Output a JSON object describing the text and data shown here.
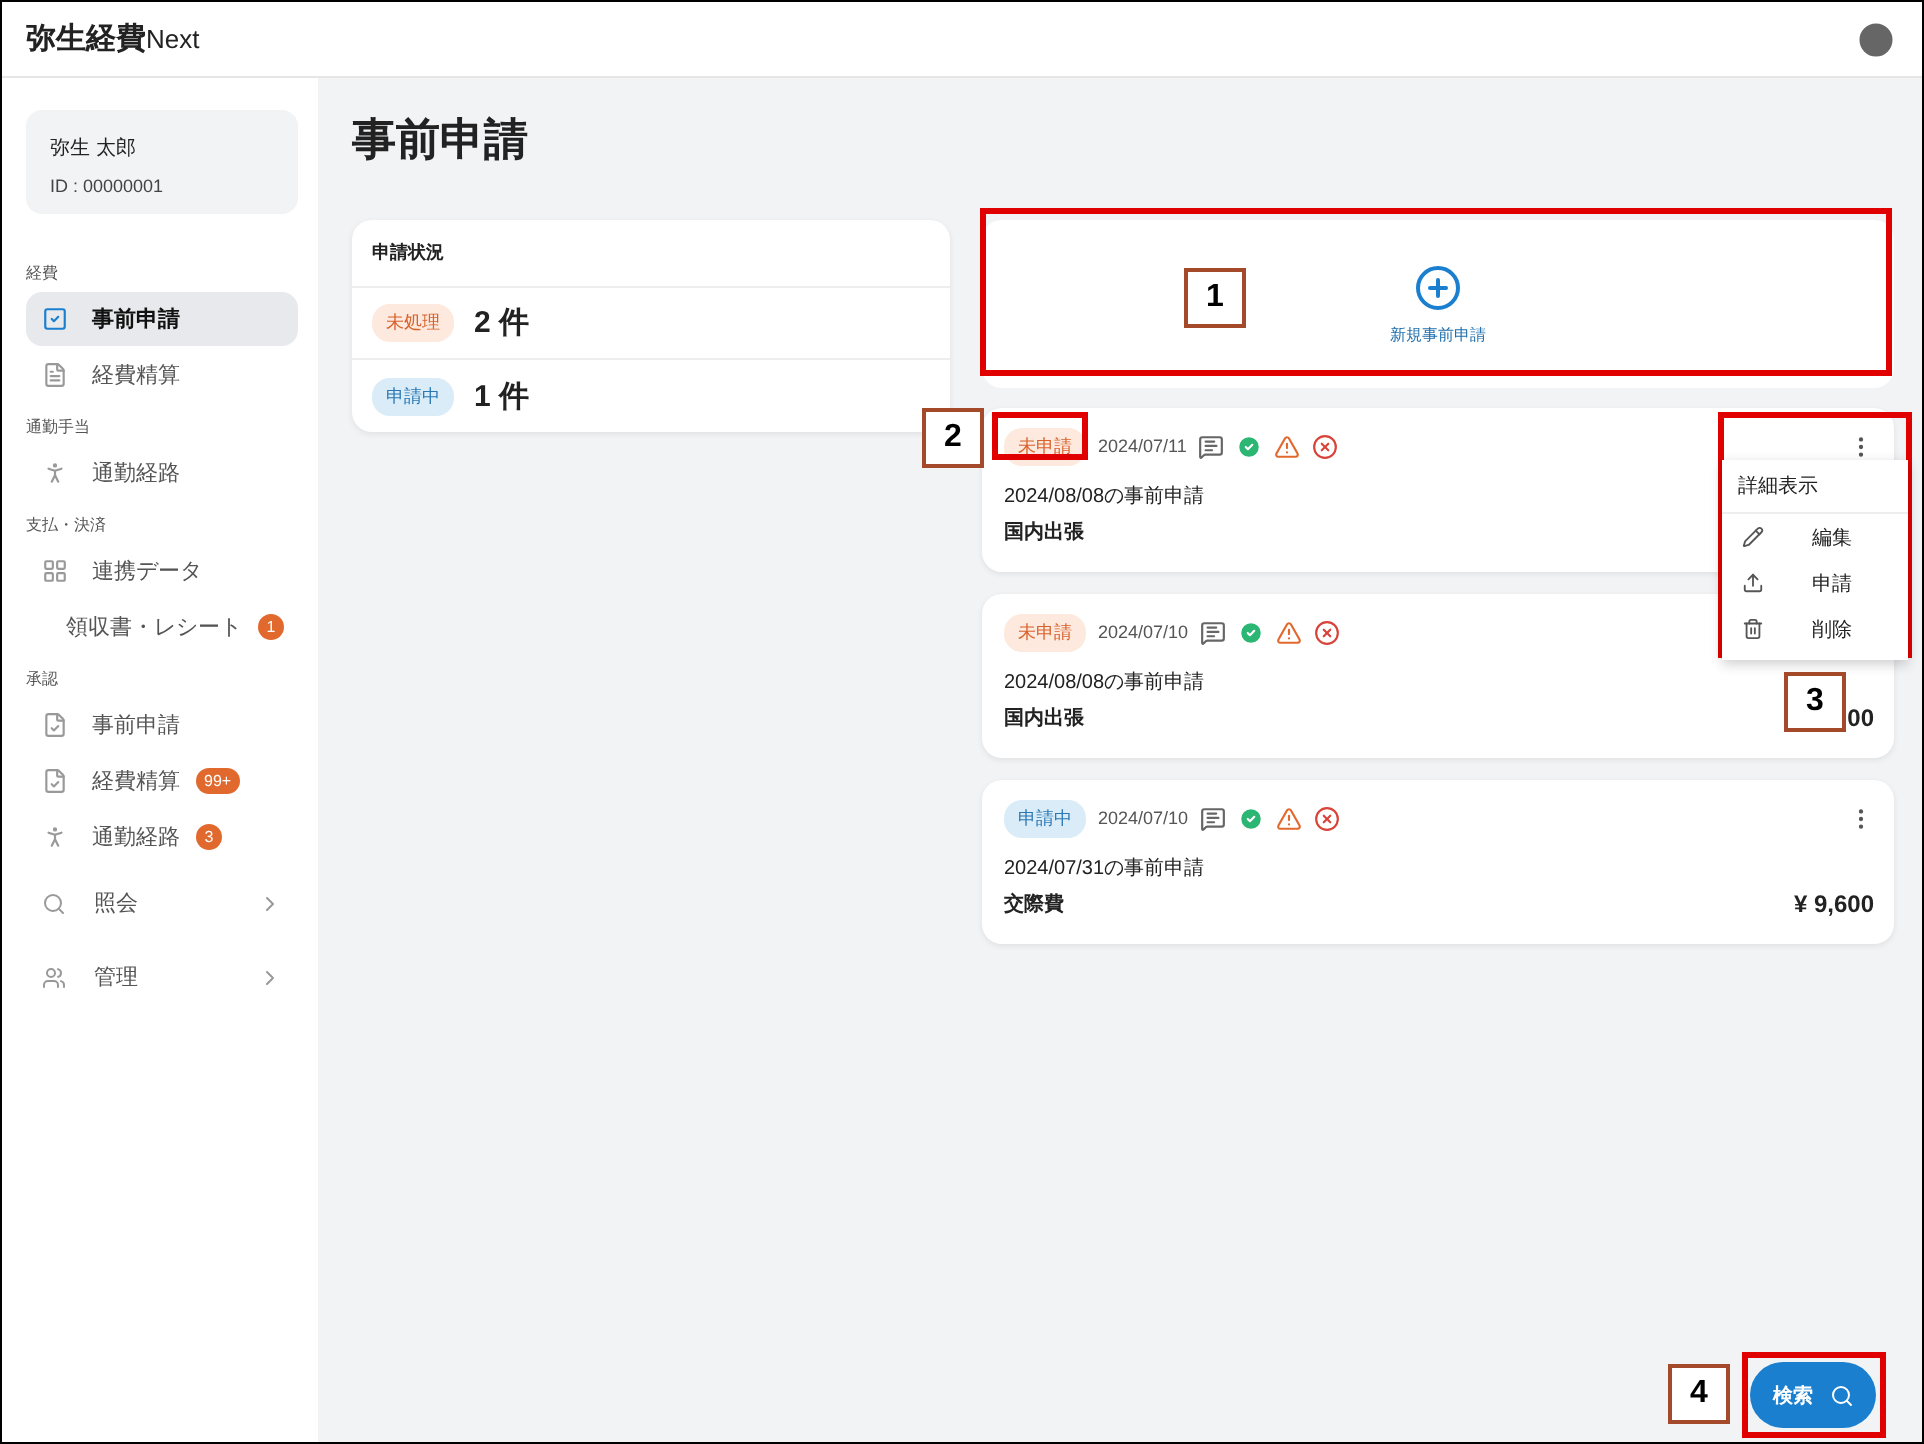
{
  "app": {
    "logo": "弥生経費",
    "logo_suffix": "Next"
  },
  "user": {
    "name": "弥生 太郎",
    "id": "ID : 00000001"
  },
  "sidebar": {
    "sections": [
      {
        "heading": "経費",
        "items": [
          {
            "label": "事前申請",
            "selected": true
          },
          {
            "label": "経費精算",
            "selected": false
          }
        ]
      },
      {
        "heading": "通勤手当",
        "items": [
          {
            "label": "通勤経路",
            "selected": false
          }
        ]
      },
      {
        "heading": "支払・決済",
        "items": [
          {
            "label": "連携データ",
            "selected": false
          },
          {
            "label": "領収書・レシート",
            "selected": false,
            "badge": "1"
          }
        ]
      },
      {
        "heading": "承認",
        "items": [
          {
            "label": "事前申請",
            "selected": false
          },
          {
            "label": "経費精算",
            "selected": false,
            "badge": "99+"
          },
          {
            "label": "通勤経路",
            "selected": false,
            "badge": "3"
          }
        ]
      }
    ],
    "groups": [
      {
        "label": "照会"
      },
      {
        "label": "管理"
      }
    ]
  },
  "page": {
    "title": "事前申請"
  },
  "status_card": {
    "title": "申請状況",
    "rows": [
      {
        "tag": "未処理",
        "kind": "pending",
        "count": "2 件"
      },
      {
        "tag": "申請中",
        "kind": "applied",
        "count": "1 件"
      }
    ]
  },
  "new_request": {
    "label": "新規事前申請"
  },
  "requests": [
    {
      "status": "未申請",
      "kind": "draft",
      "date": "2024/07/11",
      "title": "2024/08/08の事前申請",
      "category": "国内出張"
    },
    {
      "status": "未申請",
      "kind": "draft",
      "date": "2024/07/10",
      "title": "2024/08/08の事前申請",
      "category": "国内出張",
      "amount": "00"
    },
    {
      "status": "申請中",
      "kind": "applied",
      "date": "2024/07/10",
      "title": "2024/07/31の事前申請",
      "category": "交際費",
      "amount": "¥ 9,600"
    }
  ],
  "context_menu": {
    "title": "詳細表示",
    "items": [
      {
        "label": "編集"
      },
      {
        "label": "申請"
      },
      {
        "label": "削除"
      }
    ]
  },
  "search_button": {
    "label": "検索"
  },
  "callouts": [
    "1",
    "2",
    "3",
    "4"
  ]
}
